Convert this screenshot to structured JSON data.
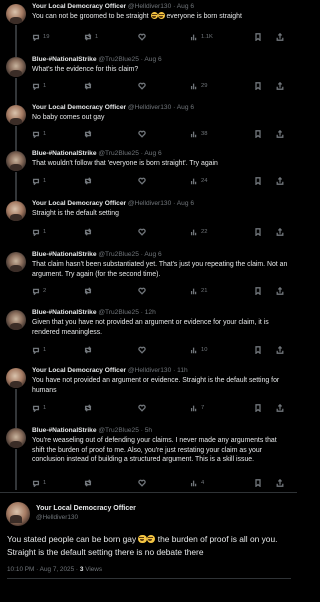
{
  "replies": [
    {
      "author": "Your Local Democracy Officer",
      "handle": "@Helldiver130",
      "time": "Aug 6",
      "text_a": "You can not be groomed to be straight",
      "text_b": "everyone is born straight",
      "replies": "19",
      "retweets": "1",
      "likes": "",
      "views": "1.1K"
    },
    {
      "author": "Blue-#NationalStrike",
      "handle": "@Tru2Blue25",
      "time": "Aug 6",
      "text": "What's the evidence for this claim?",
      "replies": "1",
      "retweets": "",
      "likes": "",
      "views": "29"
    },
    {
      "author": "Your Local Democracy Officer",
      "handle": "@Helldiver130",
      "time": "Aug 6",
      "text": "No baby comes out gay",
      "replies": "1",
      "retweets": "",
      "likes": "",
      "views": "38"
    },
    {
      "author": "Blue-#NationalStrike",
      "handle": "@Tru2Blue25",
      "time": "Aug 6",
      "text": "That wouldn't follow that 'everyone is born straight'. Try again",
      "replies": "1",
      "retweets": "",
      "likes": "",
      "views": "24"
    },
    {
      "author": "Your Local Democracy Officer",
      "handle": "@Helldiver130",
      "time": "Aug 6",
      "text": "Straight is the default setting",
      "replies": "1",
      "retweets": "",
      "likes": "",
      "views": "22"
    },
    {
      "author": "Blue-#NationalStrike",
      "handle": "@Tru2Blue25",
      "time": "Aug 6",
      "text": "That claim hasn't been substantiated yet. That's just you repeating the claim. Not an argument. Try again (for the second time).",
      "replies": "2",
      "retweets": "",
      "likes": "",
      "views": "21"
    },
    {
      "author": "Blue-#NationalStrike",
      "handle": "@Tru2Blue25",
      "time": "12h",
      "text": "Given that you have not provided an argument or evidence for your claim, it is rendered meaningless.",
      "replies": "1",
      "retweets": "",
      "likes": "",
      "views": "10"
    },
    {
      "author": "Your Local Democracy Officer",
      "handle": "@Helldiver130",
      "time": "11h",
      "text": "You have not provided an argument or evidence. Straight is the default setting for humans",
      "replies": "1",
      "retweets": "",
      "likes": "",
      "views": "7"
    },
    {
      "author": "Blue-#NationalStrike",
      "handle": "@Tru2Blue25",
      "time": "5h",
      "text": "You're weaseling out of defending your claims. I never made any arguments that shift the burden of proof to me. Also, you're just restating your claim as your conclusion instead of building a structured argument. This is a skill issue.",
      "replies": "1",
      "retweets": "",
      "likes": "",
      "views": "4"
    }
  ],
  "main_post": {
    "author": "Your Local Democracy Officer",
    "handle": "@Helldiver130",
    "text_a": "You stated people can be born gay",
    "text_b": "the burden of proof is all on you. Straight is the default setting there is no debate there",
    "timestamp": "10:10 PM · Aug 7, 2025 ·",
    "views_count": "3",
    "views_label": "Views"
  },
  "icons": {
    "reply": "reply-icon",
    "retweet": "retweet-icon",
    "like": "heart-icon",
    "views": "views-icon",
    "bookmark": "bookmark-icon",
    "share": "share-icon"
  },
  "colors": {
    "background": "#000000",
    "text": "#e7e9ea",
    "muted": "#71767b",
    "rail": "#333639"
  }
}
